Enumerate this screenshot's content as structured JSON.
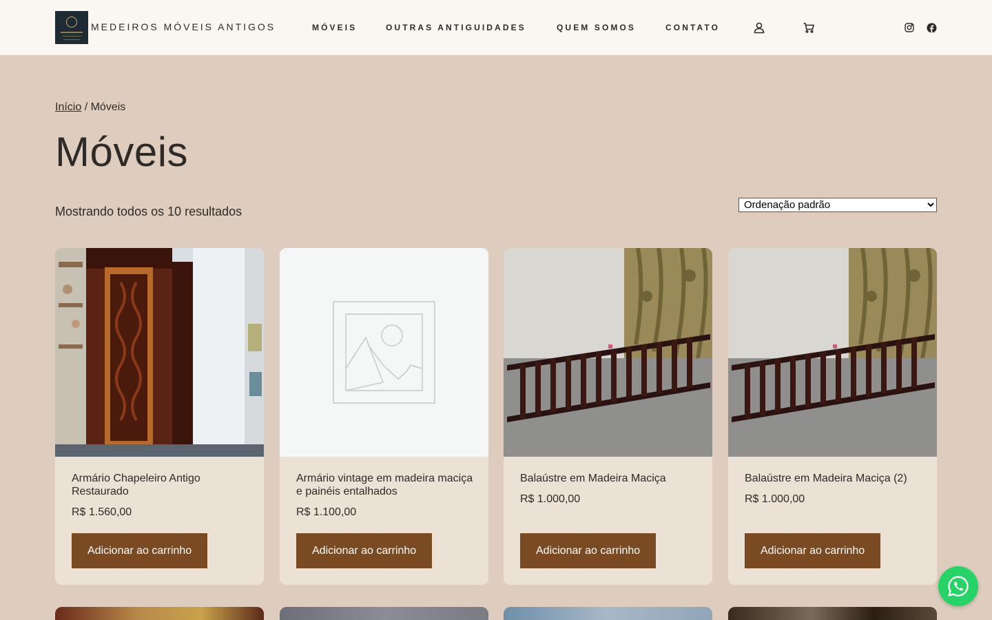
{
  "header": {
    "brand": "MEDEIROS MÓVEIS ANTIGOS",
    "nav": [
      "MÓVEIS",
      "OUTRAS ANTIGUIDADES",
      "QUEM SOMOS",
      "CONTATO"
    ],
    "icons": [
      "user-icon",
      "cart-icon",
      "instagram-icon",
      "facebook-icon"
    ]
  },
  "breadcrumb": {
    "home": "Início",
    "separator": " / ",
    "current": "Móveis"
  },
  "page_title": "Móveis",
  "result_count": "Mostrando todos os 10 resultados",
  "sort": {
    "selected": "Ordenação padrão"
  },
  "products": [
    {
      "name": "Armário Chapeleiro Antigo Restaurado",
      "price": "R$ 1.560,00",
      "button": "Adicionar ao carrinho"
    },
    {
      "name": "Armário vintage em madeira maciça e painéis entalhados",
      "price": "R$ 1.100,00",
      "button": "Adicionar ao carrinho"
    },
    {
      "name": "Balaústre em Madeira Maciça",
      "price": "R$ 1.000,00",
      "button": "Adicionar ao carrinho"
    },
    {
      "name": "Balaústre em Madeira Maciça (2)",
      "price": "R$ 1.000,00",
      "button": "Adicionar ao carrinho"
    }
  ],
  "colors": {
    "background": "#decdbe",
    "header": "#faf7f2",
    "card": "#ebe1d5",
    "button": "#7a4a23",
    "whatsapp": "#25d366"
  }
}
